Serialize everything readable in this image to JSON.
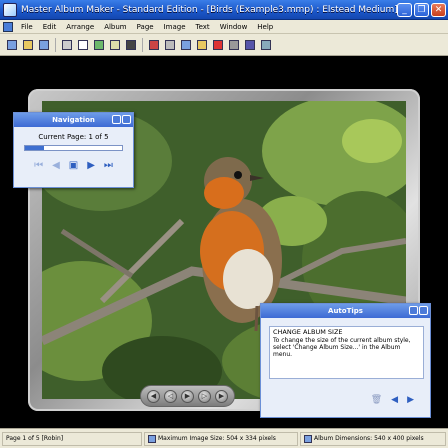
{
  "window": {
    "title": "Master Album Maker - Standard Edition - [Birds (Example3.mmp) : Elstead Medium]",
    "controls": [
      "minimize",
      "restore",
      "close"
    ]
  },
  "menubar": {
    "items": [
      "File",
      "Edit",
      "Arrange",
      "Album",
      "Page",
      "Image",
      "Text",
      "Window",
      "Help"
    ]
  },
  "toolbar": {
    "buttons": [
      "new-album-icon",
      "open-icon",
      "save-icon",
      "print-icon",
      "add-page-icon",
      "import-image-icon",
      "slide-icon",
      "film-icon",
      "layout-icon",
      "cut-icon",
      "copy-icon",
      "paste-icon",
      "delete-icon",
      "text-icon",
      "draw-icon",
      "zoom-icon"
    ]
  },
  "navigation": {
    "title": "Navigation",
    "current_page": "Current Page: 1 of 5",
    "progress_fraction": 0.2,
    "buttons": [
      "first-page-icon",
      "previous-page-icon",
      "go-to-page-icon",
      "next-page-icon",
      "last-page-icon"
    ]
  },
  "autotips": {
    "title": "AutoTips",
    "heading": "CHANGE ALBUM SIZE",
    "body": "To change the size of the current album style, select 'Change Album Size...' in the Album menu."
  },
  "statusbar": {
    "page": "Page 1 of 5 [Robin]",
    "max_image_size": "Maximum Image Size: 504 x 334 pixels",
    "album_dimensions": "Album Dimensions: 540 x 400 pixels"
  },
  "colors": {
    "titlebar": "#1a56c8",
    "panel_title": "#3d6ad4",
    "canvas_bg": "#000000"
  }
}
